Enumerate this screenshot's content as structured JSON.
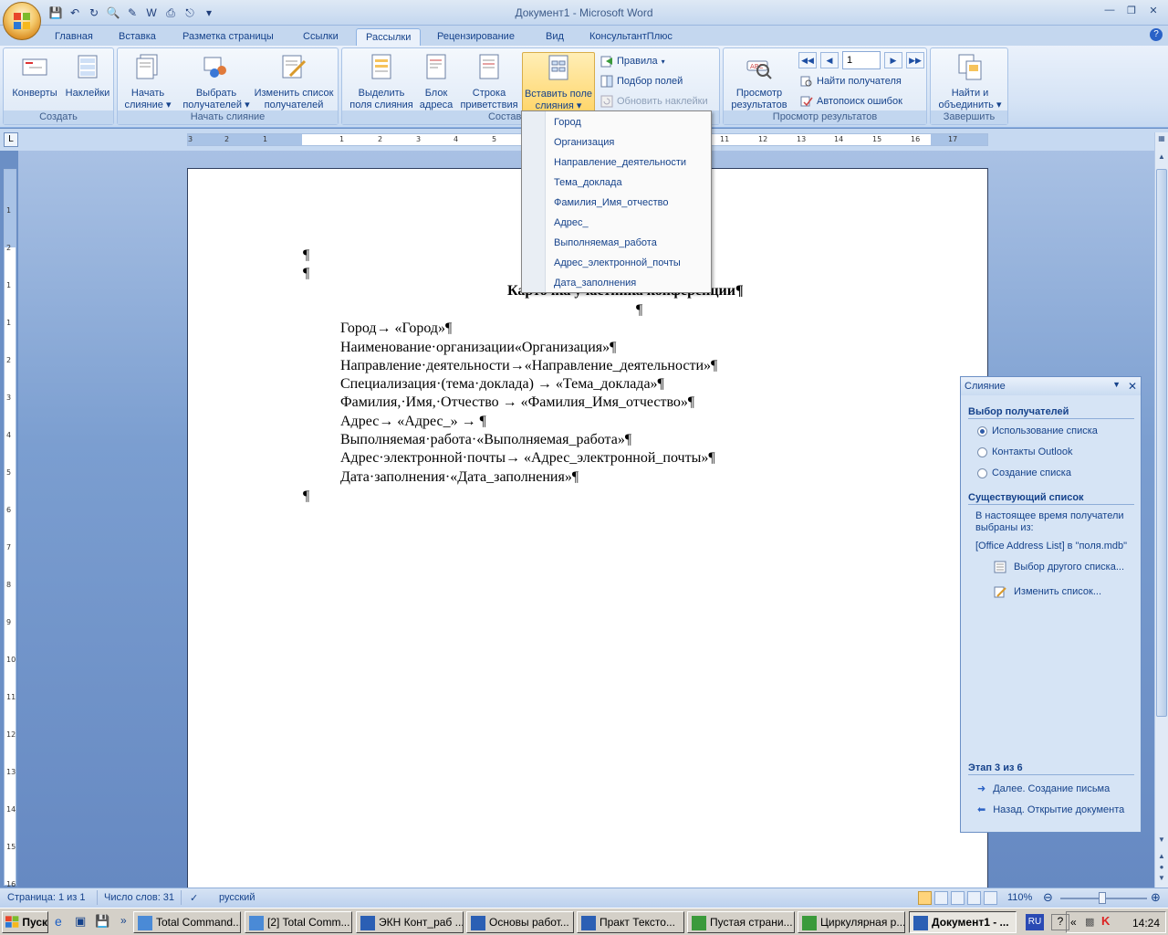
{
  "window": {
    "title": "Документ1 - Microsoft Word"
  },
  "tabs": [
    "Главная",
    "Вставка",
    "Разметка страницы",
    "Ссылки",
    "Рассылки",
    "Рецензирование",
    "Вид",
    "КонсультантПлюс"
  ],
  "ribbon": {
    "groups": {
      "create": "Создать",
      "start_merge": "Начать слияние",
      "write_insert": "Составление доку",
      "preview": "Просмотр результатов",
      "finish": "Завершить"
    },
    "buttons": {
      "envelopes": "Конверты",
      "labels": "Наклейки",
      "start_merge": [
        "Начать",
        "слияние"
      ],
      "select_recipients": [
        "Выбрать",
        "получателей"
      ],
      "edit_list": [
        "Изменить список",
        "получателей"
      ],
      "highlight_fields": [
        "Выделить",
        "поля слияния"
      ],
      "address_block": [
        "Блок",
        "адреса"
      ],
      "greeting": [
        "Строка",
        "приветствия"
      ],
      "insert_field": [
        "Вставить поле",
        "слияния"
      ],
      "rules": "Правила",
      "match_fields": "Подбор полей",
      "update_labels": "Обновить наклейки",
      "preview_results": [
        "Просмотр",
        "результатов"
      ],
      "find_recipient": "Найти получателя",
      "auto_check": "Автопоиск ошибок",
      "finish_merge": [
        "Найти и",
        "объединить"
      ]
    },
    "record_number": "1"
  },
  "ruler": {
    "h_numbers": [
      "3",
      "2",
      "1",
      "1",
      "2",
      "3",
      "4",
      "5",
      "11",
      "12",
      "13",
      "14",
      "15",
      "16",
      "17"
    ],
    "v_numbers": [
      "1",
      "2",
      "1",
      "1",
      "2",
      "3",
      "4",
      "5",
      "6",
      "7",
      "8",
      "9",
      "10",
      "11",
      "12",
      "13",
      "14",
      "15",
      "16"
    ]
  },
  "merge_fields_dropdown": [
    "Город",
    "Организация",
    "Направление_деятельности",
    "Тема_доклада",
    "Фамилия_Имя_отчество",
    "Адрес_",
    "Выполняемая_работа",
    "Адрес_электронной_почты",
    "Дата_заполнения"
  ],
  "document": {
    "pilcrow": "¶",
    "title": "Карточка участника конференции¶",
    "lines": [
      "Город→ «Город»¶",
      "Наименование·организации«Организация»¶",
      "Направление·деятельности→«Направление_деятельности»¶",
      "Специализация·(тема·доклада)  →  «Тема_доклада»¶",
      "Фамилия,·Имя,·Отчество → «Фамилия_Имя_отчество»¶",
      "Адрес→ «Адрес_» →  ¶",
      "Выполняемая·работа·«Выполняемая_работа»¶",
      "Адрес·электронной·почты→ «Адрес_электронной_почты»¶",
      "Дата·заполнения·«Дата_заполнения»¶"
    ]
  },
  "taskpane": {
    "title": "Слияние",
    "section_recipients": "Выбор получателей",
    "radio_options": [
      "Использование списка",
      "Контакты Outlook",
      "Создание списка"
    ],
    "selected_radio": 0,
    "section_existing": "Существующий список",
    "existing_text": "В настоящее время получатели выбраны из:",
    "source": "[Office Address List] в \"поля.mdb\"",
    "link_choose_other": "Выбор другого списка...",
    "link_edit_list": "Изменить список...",
    "step": "Этап 3 из 6",
    "next": "Далее. Создание письма",
    "back": "Назад. Открытие документа"
  },
  "statusbar": {
    "page": "Страница: 1 из 1",
    "words": "Число слов: 31",
    "language": "русский",
    "zoom": "110%"
  },
  "taskbar": {
    "start": "Пуск",
    "tasks": [
      "Total Command...",
      "[2] Total Comm...",
      "ЭКН Конт_раб ...",
      "Основы работ...",
      "Практ Тексто...",
      "Пустая страни...",
      "Циркулярная р...",
      "Документ1 - ..."
    ],
    "active_task": 7,
    "lang": "RU",
    "clock": "14:24"
  }
}
